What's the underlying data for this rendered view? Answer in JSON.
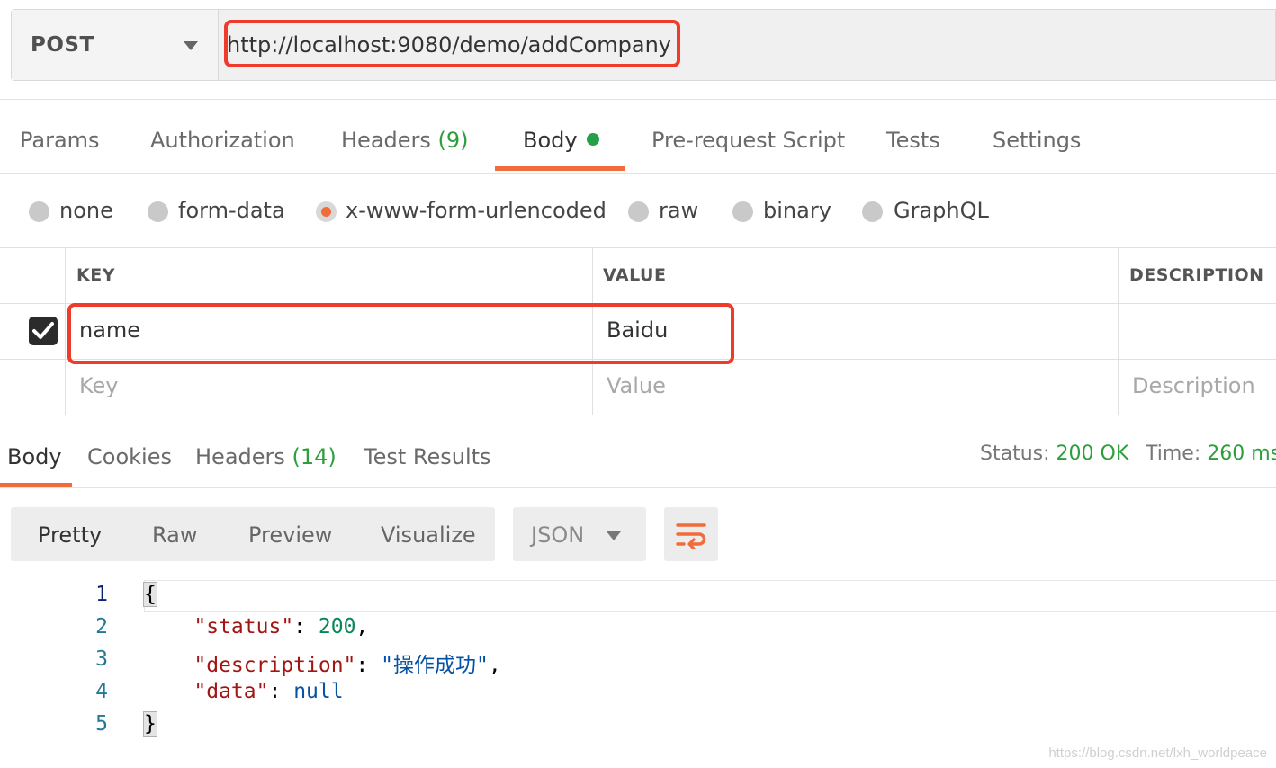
{
  "request": {
    "method": "POST",
    "url": "http://localhost:9080/demo/addCompany"
  },
  "request_tabs": [
    {
      "label": "Params"
    },
    {
      "label": "Authorization"
    },
    {
      "label": "Headers",
      "count": "(9)"
    },
    {
      "label": "Body",
      "active": true,
      "indicator": "green-dot-icon"
    },
    {
      "label": "Pre-request Script"
    },
    {
      "label": "Tests"
    },
    {
      "label": "Settings"
    }
  ],
  "body_types": [
    {
      "label": "none",
      "selected": false
    },
    {
      "label": "form-data",
      "selected": false
    },
    {
      "label": "x-www-form-urlencoded",
      "selected": true
    },
    {
      "label": "raw",
      "selected": false
    },
    {
      "label": "binary",
      "selected": false
    },
    {
      "label": "GraphQL",
      "selected": false
    }
  ],
  "params_table": {
    "columns": [
      "KEY",
      "VALUE",
      "DESCRIPTION"
    ],
    "rows": [
      {
        "checked": true,
        "key": "name",
        "value": "Baidu",
        "description": ""
      }
    ],
    "placeholders": {
      "key": "Key",
      "value": "Value",
      "description": "Description"
    }
  },
  "response_tabs": [
    {
      "label": "Body",
      "active": true
    },
    {
      "label": "Cookies"
    },
    {
      "label": "Headers",
      "count": "(14)"
    },
    {
      "label": "Test Results"
    }
  ],
  "response_meta": {
    "status_label": "Status:",
    "status_value": "200 OK",
    "time_label": "Time:",
    "time_value": "260 ms"
  },
  "view_modes": [
    {
      "label": "Pretty",
      "active": true
    },
    {
      "label": "Raw"
    },
    {
      "label": "Preview"
    },
    {
      "label": "Visualize"
    }
  ],
  "format": "JSON",
  "wrap_icon": "wrap-lines-icon",
  "response_body": {
    "line_numbers": [
      "1",
      "2",
      "3",
      "4",
      "5"
    ],
    "open_brace": "{",
    "close_brace": "}",
    "status_key": "\"status\"",
    "status_value": "200",
    "description_key": "\"description\"",
    "description_value": "\"操作成功\"",
    "data_key": "\"data\"",
    "data_value": "null"
  },
  "watermark": "https://blog.csdn.net/lxh_worldpeace",
  "colors": {
    "accent": "#f26b3a",
    "success": "#2c9f3c",
    "highlight_box": "#ee3b2b"
  }
}
